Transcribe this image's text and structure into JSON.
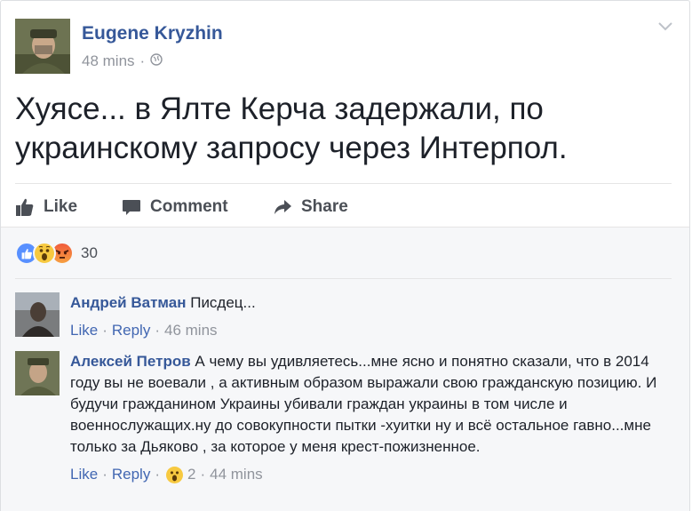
{
  "post": {
    "author": "Eugene Kryzhin",
    "time": "48 mins",
    "separator": "·",
    "text": "Хуясе... в Ялте Керча задержали, по украинскому запросу через Интерпол."
  },
  "actions": {
    "like": "Like",
    "comment": "Comment",
    "share": "Share"
  },
  "reactions": {
    "count": "30",
    "types": [
      "like-icon",
      "wow-icon",
      "angry-icon"
    ]
  },
  "comments": [
    {
      "author": "Андрей Ватман",
      "text": "Писдец...",
      "like": "Like",
      "reply": "Reply",
      "time": "46 mins"
    },
    {
      "author": "Алексей Петров",
      "text": "А чему вы удивляетесь...мне ясно и понятно сказали, что в 2014 году вы не воевали , а активным образом выражали свою гражданскую позицию. И будучи гражданином Украины убивали граждан украины в том числе и военнослужащих.ну до совокупности пытки -хуитки ну и всё остальное гавно...мне только за Дьяково , за которое у меня крест-пожизненное.",
      "like": "Like",
      "reply": "Reply",
      "reaction_count": "2",
      "time": "44 mins"
    }
  ],
  "colors": {
    "link": "#365899",
    "action": "#4b4f56",
    "meta": "#90949c",
    "comment_bg": "#f6f7f9"
  }
}
